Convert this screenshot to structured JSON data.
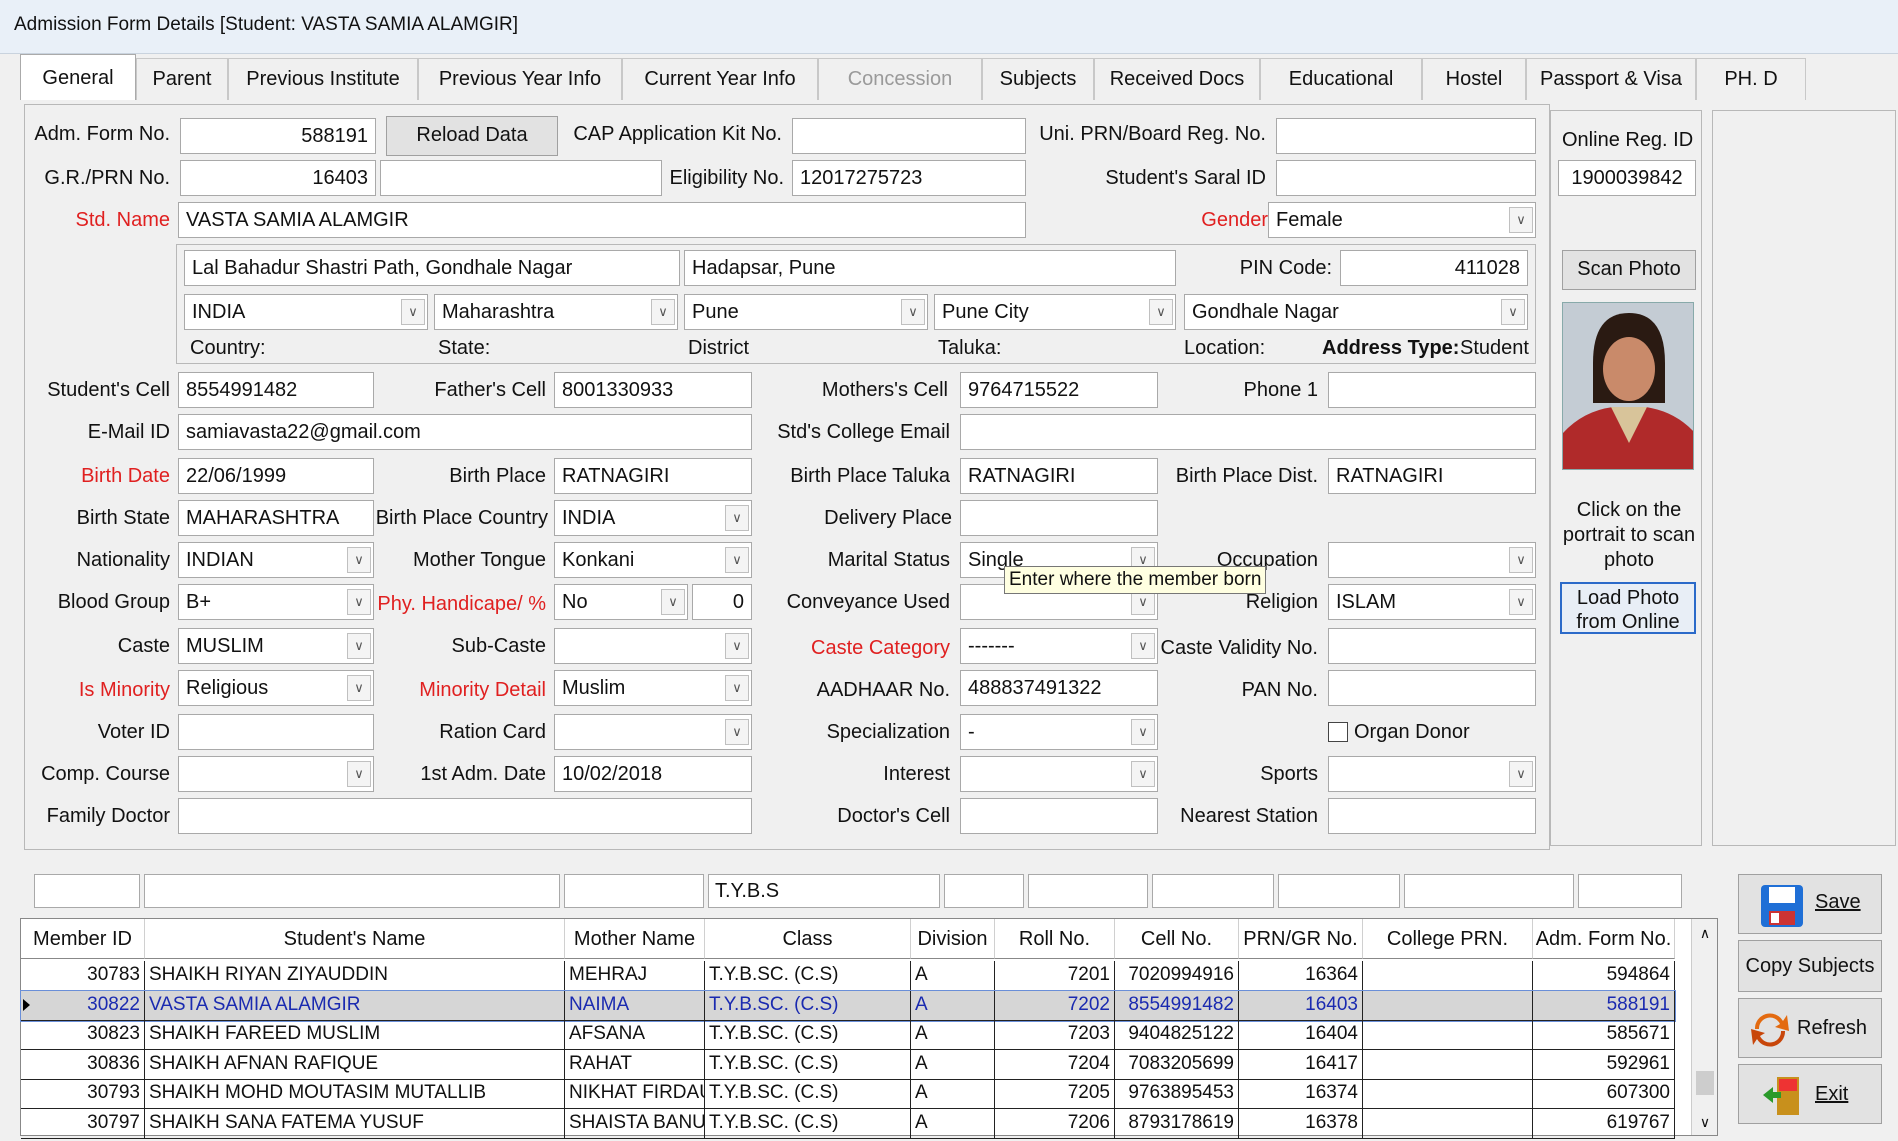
{
  "window": {
    "title": "Admission Form Details [Student: VASTA SAMIA ALAMGIR]"
  },
  "tabs": [
    {
      "label": "General"
    },
    {
      "label": "Parent"
    },
    {
      "label": "Previous Institute"
    },
    {
      "label": "Previous Year Info"
    },
    {
      "label": "Current Year Info"
    },
    {
      "label": "Concession"
    },
    {
      "label": "Subjects"
    },
    {
      "label": "Received Docs"
    },
    {
      "label": "Educational"
    },
    {
      "label": "Hostel"
    },
    {
      "label": "Passport & Visa"
    },
    {
      "label": "PH. D"
    }
  ],
  "form": {
    "adm_form_no_label": "Adm. Form No.",
    "adm_form_no": "588191",
    "reload_button": "Reload Data",
    "cap_label": "CAP Application Kit No.",
    "cap": "",
    "uni_prn_label": "Uni. PRN/Board Reg. No.",
    "uni_prn": "",
    "gr_prn_label": "G.R./PRN No.",
    "gr_prn": "16403",
    "gr_extra": "",
    "eligibility_label": "Eligibility No.",
    "eligibility": "12017275723",
    "saral_label": "Student's Saral ID",
    "saral": "",
    "std_name_label": "Std. Name",
    "std_name": "VASTA SAMIA ALAMGIR",
    "gender_label": "Gender",
    "gender": "Female",
    "address1": "Lal Bahadur Shastri Path, Gondhale Nagar",
    "address2": "Hadapsar, Pune",
    "pin_label": "PIN Code:",
    "pin": "411028",
    "country": "INDIA",
    "state": "Maharashtra",
    "district": "Pune",
    "taluka": "Pune City",
    "location": "Gondhale Nagar",
    "country_label": "Country:",
    "state_label": "State:",
    "district_label": "District",
    "taluka_label": "Taluka:",
    "location_label": "Location:",
    "address_type_label": "Address Type:",
    "address_type": "Student",
    "student_cell_label": "Student's Cell",
    "student_cell": "8554991482",
    "father_cell_label": "Father's Cell",
    "father_cell": "8001330933",
    "mother_cell_label": "Mothers's Cell",
    "mother_cell": "9764715522",
    "phone1_label": "Phone 1",
    "phone1": "",
    "email_label": "E-Mail ID",
    "email": "samiavasta22@gmail.com",
    "college_email_label": "Std's College Email",
    "college_email": "",
    "birth_date_label": "Birth Date",
    "birth_date": "22/06/1999",
    "birth_place_label": "Birth Place",
    "birth_place": "RATNAGIRI",
    "birth_taluka_label": "Birth Place Taluka",
    "birth_taluka": "RATNAGIRI",
    "birth_dist_label": "Birth Place Dist.",
    "birth_dist": "RATNAGIRI",
    "birth_state_label": "Birth State",
    "birth_state": "MAHARASHTRA",
    "birth_country_label": "Birth Place Country",
    "birth_country": "INDIA",
    "delivery_label": "Delivery Place",
    "delivery": "",
    "nationality_label": "Nationality",
    "nationality": "INDIAN",
    "mother_tongue_label": "Mother Tongue",
    "mother_tongue": "Konkani",
    "marital_label": "Marital Status",
    "marital": "Single",
    "occupation_label": "Occupation",
    "occupation": "",
    "blood_label": "Blood Group",
    "blood": "B+",
    "handicap_label": "Phy. Handicape/ %",
    "handicap": "No",
    "handicap_pct": "0",
    "conveyance_label": "Conveyance Used",
    "conveyance": "",
    "religion_label": "Religion",
    "religion": "ISLAM",
    "caste_label": "Caste",
    "caste": "MUSLIM",
    "subcaste_label": "Sub-Caste",
    "subcaste": "",
    "caste_cat_label": "Caste Category",
    "caste_cat": "-------",
    "caste_validity_label": "Caste Validity No.",
    "caste_validity": "",
    "minority_label": "Is Minority",
    "minority": "Religious",
    "minority_detail_label": "Minority Detail",
    "minority_detail": "Muslim",
    "aadhaar_label": "AADHAAR No.",
    "aadhaar": "488837491322",
    "pan_label": "PAN No.",
    "pan": "",
    "voter_label": "Voter ID",
    "voter": "",
    "ration_label": "Ration Card",
    "ration": "",
    "specialization_label": "Specialization",
    "specialization": "-",
    "organ_label": "Organ Donor",
    "comp_course_label": "Comp. Course",
    "comp_course": "",
    "first_adm_label": "1st Adm. Date",
    "first_adm": "10/02/2018",
    "interest_label": "Interest",
    "interest": "",
    "sports_label": "Sports",
    "sports": "",
    "family_doc_label": "Family Doctor",
    "family_doc": "",
    "doc_cell_label": "Doctor's Cell",
    "doc_cell": "",
    "station_label": "Nearest Station",
    "station": "",
    "tooltip": "Enter where the member born"
  },
  "side": {
    "online_reg_label": "Online Reg. ID",
    "online_reg": "1900039842",
    "scan_button": "Scan Photo",
    "hint": "Click on the portrait to scan photo",
    "load_button": "Load Photo from Online"
  },
  "grid": {
    "filter_class": "T.Y.B.S",
    "headers": [
      "Member ID",
      "Student's Name",
      "Mother Name",
      "Class",
      "Division",
      "Roll No.",
      "Cell No.",
      "PRN/GR No.",
      "College PRN.",
      "Adm. Form No."
    ],
    "rows": [
      [
        "30783",
        "SHAIKH RIYAN ZIYAUDDIN",
        "MEHRAJ",
        "T.Y.B.SC. (C.S)",
        "A",
        "7201",
        "7020994916",
        "16364",
        "",
        "594864"
      ],
      [
        "30822",
        "VASTA SAMIA ALAMGIR",
        "NAIMA",
        "T.Y.B.SC. (C.S)",
        "A",
        "7202",
        "8554991482",
        "16403",
        "",
        "588191"
      ],
      [
        "30823",
        "SHAIKH FAREED MUSLIM",
        "AFSANA",
        "T.Y.B.SC. (C.S)",
        "A",
        "7203",
        "9404825122",
        "16404",
        "",
        "585671"
      ],
      [
        "30836",
        "SHAIKH AFNAN RAFIQUE",
        "RAHAT",
        "T.Y.B.SC. (C.S)",
        "A",
        "7204",
        "7083205699",
        "16417",
        "",
        "592961"
      ],
      [
        "30793",
        "SHAIKH MOHD MOUTASIM MUTALLIB",
        "NIKHAT FIRDAUS",
        "T.Y.B.SC. (C.S)",
        "A",
        "7205",
        "9763895453",
        "16374",
        "",
        "607300"
      ],
      [
        "30797",
        "SHAIKH SANA FATEMA YUSUF",
        "SHAISTA BANU",
        "T.Y.B.SC. (C.S)",
        "A",
        "7206",
        "8793178619",
        "16378",
        "",
        "619767"
      ]
    ]
  },
  "actions": {
    "save": "Save",
    "copy": "Copy Subjects",
    "refresh": "Refresh",
    "exit": "Exit"
  }
}
